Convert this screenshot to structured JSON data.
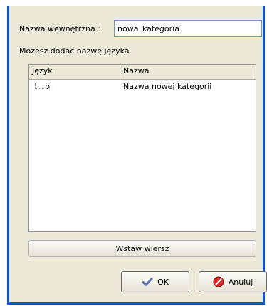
{
  "form": {
    "internal_name_label": "Nazwa wewnętrzna :",
    "internal_name_value": "nowa_kategoria",
    "hint": "Możesz dodać nazwę języka."
  },
  "table": {
    "columns": [
      "Język",
      "Nazwa"
    ],
    "rows": [
      {
        "language": "pl",
        "name": "Nazwa nowej kategorii"
      }
    ]
  },
  "buttons": {
    "insert_row": "Wstaw wiersz",
    "ok": "OK",
    "cancel": "Anuluj"
  },
  "icons": {
    "ok": "check-icon",
    "cancel": "cancel-icon"
  },
  "colors": {
    "window_border": "#0A52D6",
    "dialog_bg": "#ECE9D8"
  }
}
